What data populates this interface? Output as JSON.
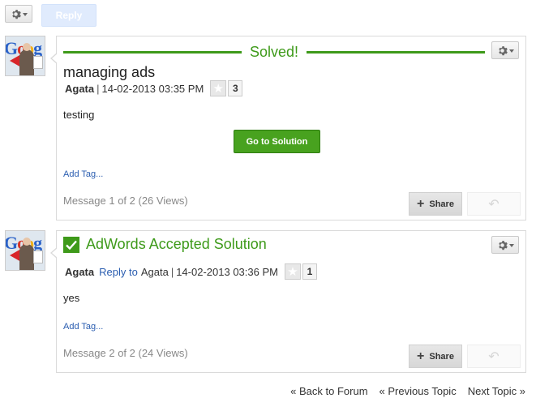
{
  "toolbar": {
    "reply_label": "Reply"
  },
  "posts": [
    {
      "banner": "Solved!",
      "subject": "managing ads",
      "author": "Agata",
      "sep": "|",
      "datetime": "14-02-2013 03:35 PM",
      "kudos": "3",
      "body": "testing",
      "solution_button": "Go to Solution",
      "add_tag": "Add Tag...",
      "message_count": "Message 1 of 2 (26 Views)",
      "share_label": "Share"
    },
    {
      "accepted_label": "AdWords Accepted Solution",
      "author": "Agata",
      "reply_to_label": "Reply to",
      "reply_to_name": "Agata",
      "sep": "|",
      "datetime": "14-02-2013 03:36 PM",
      "kudos": "1",
      "body": "yes",
      "add_tag": "Add Tag...",
      "message_count": "Message 2 of 2 (24 Views)",
      "share_label": "Share"
    }
  ],
  "nav": {
    "back": "« Back to Forum",
    "prev": "« Previous Topic",
    "next": "Next Topic »"
  },
  "colors": {
    "accent_green": "#3e9a1a",
    "link_blue": "#2a5db0"
  },
  "icons": [
    "gear-icon",
    "star-icon",
    "check-icon",
    "plus-icon",
    "reply-arrow-icon"
  ]
}
